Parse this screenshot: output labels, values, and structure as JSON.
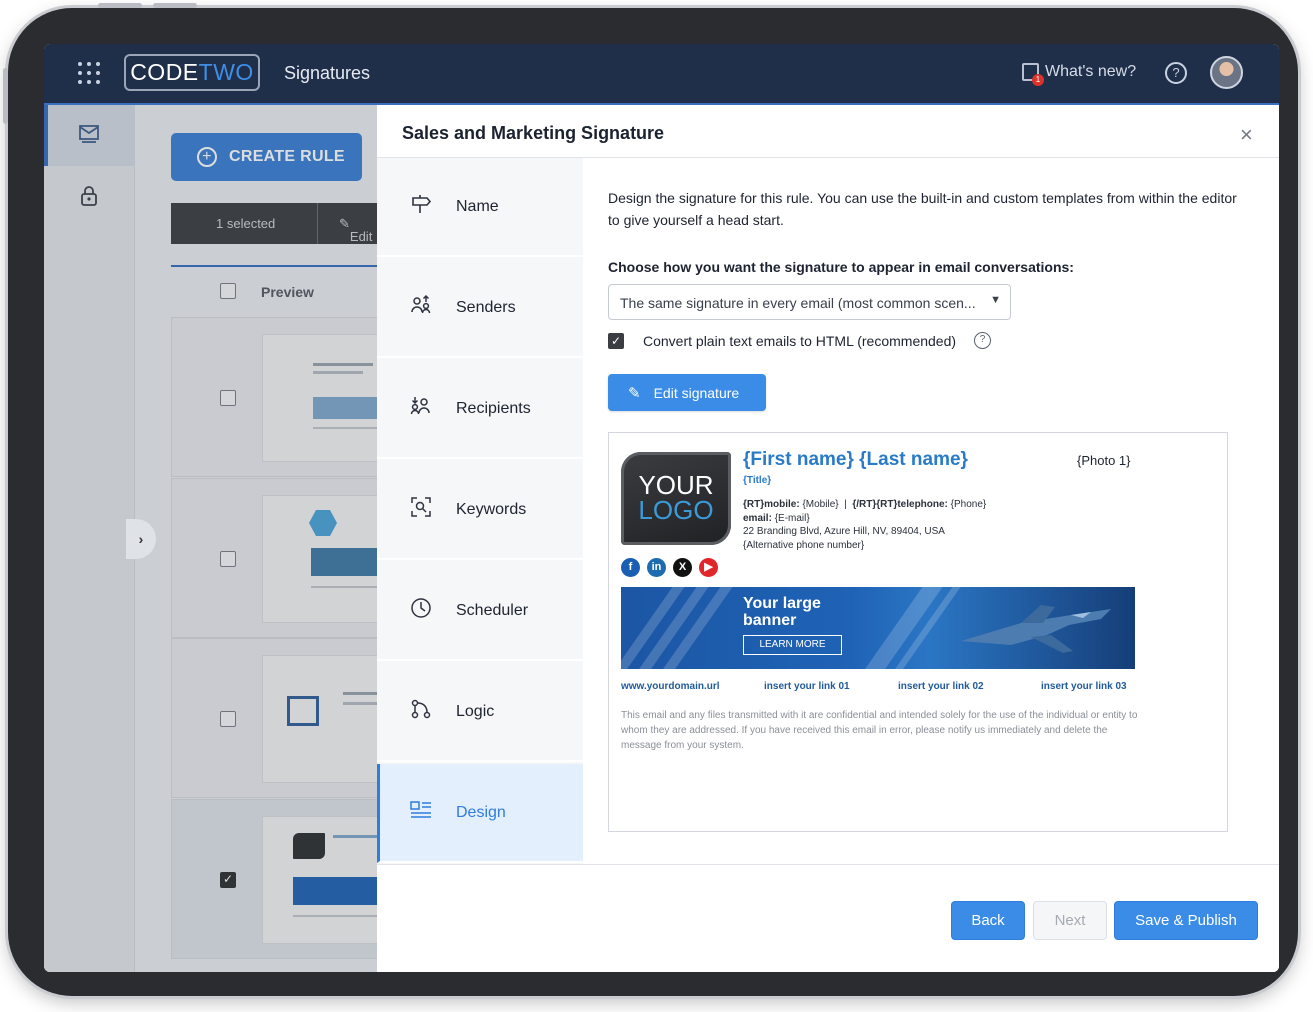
{
  "topbar": {
    "brand_code": "CODE",
    "brand_two": "TWO",
    "app_title": "Signatures",
    "whats_new": "What's new?",
    "news_badge": "1",
    "help": "?"
  },
  "background": {
    "create_rule": "CREATE RULE",
    "selected": "1 selected",
    "edit": "Edit",
    "preview_col": "Preview"
  },
  "modal": {
    "title": "Sales and Marketing Signature",
    "close": "×",
    "steps": [
      {
        "label": "Name",
        "icon": "signpost-icon"
      },
      {
        "label": "Senders",
        "icon": "senders-icon"
      },
      {
        "label": "Recipients",
        "icon": "recipients-icon"
      },
      {
        "label": "Keywords",
        "icon": "keywords-icon"
      },
      {
        "label": "Scheduler",
        "icon": "clock-icon"
      },
      {
        "label": "Logic",
        "icon": "logic-icon"
      },
      {
        "label": "Design",
        "icon": "design-icon"
      }
    ],
    "active_step": "Design",
    "intro": "Design the signature for this rule. You can use the built-in and custom templates from within the editor to give yourself a head start.",
    "choose_label": "Choose how you want the signature to appear in email conversations:",
    "select_value": "The same signature in every email (most common scen...",
    "convert_label": "Convert plain text emails to HTML (recommended)",
    "convert_checked": true,
    "edit_signature": "Edit signature",
    "back": "Back",
    "next": "Next",
    "save_publish": "Save & Publish"
  },
  "signature": {
    "logo_line1": "YOUR",
    "logo_line2": "LOGO",
    "name": "{First name} {Last name}",
    "title": "{Title}",
    "photo": "{Photo 1}",
    "mobile_label": "{RT}mobile:",
    "mobile_value": "{Mobile}",
    "sep": "|",
    "telephone_label": "{/RT}{RT}telephone:",
    "telephone_value": "{Phone}",
    "email_label": "email:",
    "email_value": "{E-mail}",
    "address": "22 Branding Blvd, Azure Hill, NV, 89404, USA",
    "alt_phone": "{Alternative phone number}",
    "socials": [
      "f",
      "in",
      "X",
      "▶"
    ],
    "banner_line1": "Your large",
    "banner_line2": "banner",
    "learn_more": "LEARN MORE",
    "links": [
      "www.yourdomain.url",
      "insert your link 01",
      "insert your link 02",
      "insert your link 03"
    ],
    "disclaimer": "This email and any files transmitted with it are confidential and intended solely for the use of the individual or entity to whom they are addressed. If you have received this email in error, please notify us immediately and delete the message from your system.",
    "colors": {
      "name": "#2a7bc7",
      "banner": "#1f63b6",
      "accent": "#3a8ce6"
    }
  }
}
